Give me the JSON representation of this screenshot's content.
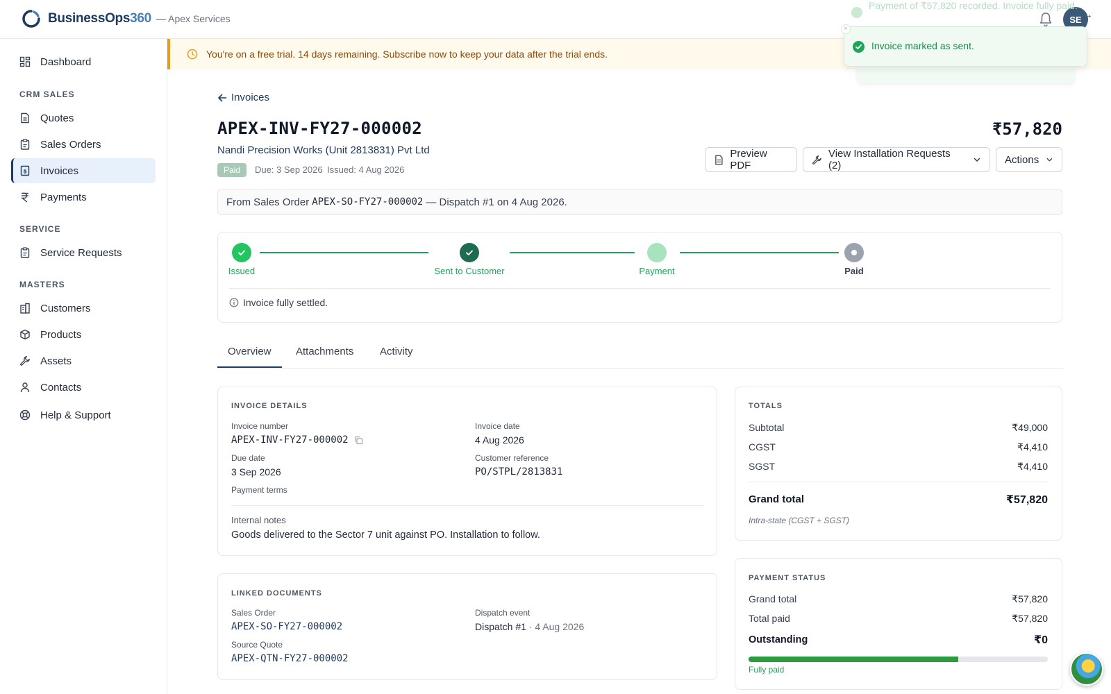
{
  "app": {
    "brand_main": "BusinessOps",
    "brand_num": "360",
    "brand_sub": "— Apex Services",
    "avatar_initials": "SE"
  },
  "sidebar": {
    "items": [
      {
        "label": "Dashboard",
        "icon": "dashboard-icon"
      },
      {
        "label": "Quotes",
        "icon": "document-icon"
      },
      {
        "label": "Sales Orders",
        "icon": "clipboard-icon"
      },
      {
        "label": "Invoices",
        "icon": "invoice-icon"
      },
      {
        "label": "Payments",
        "icon": "rupee-icon"
      },
      {
        "label": "Service Requests",
        "icon": "clipboard-icon"
      },
      {
        "label": "Customers",
        "icon": "building-icon"
      },
      {
        "label": "Products",
        "icon": "box-icon"
      },
      {
        "label": "Assets",
        "icon": "wrench-icon"
      },
      {
        "label": "Contacts",
        "icon": "user-icon"
      },
      {
        "label": "Help & Support",
        "icon": "lifebuoy-icon"
      }
    ],
    "sections": [
      "CRM SALES",
      "SERVICE",
      "MASTERS"
    ]
  },
  "banner": {
    "text": "You're on a free trial. 14 days remaining. Subscribe now to keep your data after the trial ends.",
    "arrow": "→"
  },
  "toasts": {
    "previous": "Payment of ₹57,820 recorded. Invoice fully paid.",
    "current": "Invoice marked as sent.",
    "close": "×"
  },
  "invoice": {
    "back_label": "Invoices",
    "number": "APEX-INV-FY27-000002",
    "customer": "Nandi Precision Works (Unit 2813831) Pvt Ltd",
    "status": "Paid",
    "due": "Due: 3 Sep 2026",
    "issued": "Issued: 4 Aug 2026",
    "amount": "₹57,820"
  },
  "buttons": {
    "preview_pdf": "Preview PDF",
    "installation": "View Installation Requests (2)",
    "actions": "Actions"
  },
  "from_box": {
    "prefix": "From Sales Order",
    "order": "APEX-SO-FY27-000002",
    "suffix": "— Dispatch #1 on 4 Aug 2026."
  },
  "stepper": {
    "steps": [
      "Issued",
      "Sent to Customer",
      "Payment",
      "Paid"
    ],
    "note": "Invoice fully settled."
  },
  "tabs": [
    "Overview",
    "Attachments",
    "Activity"
  ],
  "details": {
    "title": "INVOICE DETAILS",
    "invoice_number_label": "Invoice number",
    "invoice_number": "APEX-INV-FY27-000002",
    "invoice_date_label": "Invoice date",
    "invoice_date": "4 Aug 2026",
    "due_date_label": "Due date",
    "due_date": "3 Sep 2026",
    "customer_ref_label": "Customer reference",
    "customer_ref": "PO/STPL/2813831",
    "payment_terms_label": "Payment terms",
    "notes_label": "Internal notes",
    "notes": "Goods delivered to the Sector 7 unit against PO. Installation to follow."
  },
  "linked": {
    "title": "LINKED DOCUMENTS",
    "sales_order_label": "Sales Order",
    "sales_order": "APEX-SO-FY27-000002",
    "dispatch_label": "Dispatch event",
    "dispatch": "Dispatch #1",
    "dispatch_date": "· 4 Aug 2026",
    "quote_label": "Source Quote",
    "quote": "APEX-QTN-FY27-000002"
  },
  "totals": {
    "title": "TOTALS",
    "subtotal_label": "Subtotal",
    "subtotal": "₹49,000",
    "cgst_label": "CGST",
    "cgst": "₹4,410",
    "sgst_label": "SGST",
    "sgst": "₹4,410",
    "grand_label": "Grand total",
    "grand": "₹57,820",
    "note": "Intra-state (CGST + SGST)"
  },
  "payment_status": {
    "title": "PAYMENT STATUS",
    "grand_label": "Grand total",
    "grand": "₹57,820",
    "paid_label": "Total paid",
    "paid": "₹57,820",
    "outstanding_label": "Outstanding",
    "outstanding": "₹0",
    "progress_fraction": 0.7,
    "status_text": "Fully paid"
  },
  "colors": {
    "brand": "#1e3a5f",
    "success": "#22a35a",
    "banner_bg": "#fffaeb",
    "banner_accent": "#e59e1b"
  }
}
